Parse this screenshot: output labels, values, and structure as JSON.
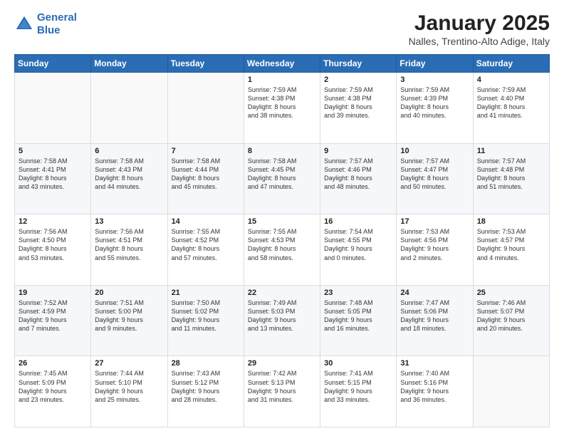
{
  "header": {
    "logo_line1": "General",
    "logo_line2": "Blue",
    "main_title": "January 2025",
    "subtitle": "Nalles, Trentino-Alto Adige, Italy"
  },
  "days_of_week": [
    "Sunday",
    "Monday",
    "Tuesday",
    "Wednesday",
    "Thursday",
    "Friday",
    "Saturday"
  ],
  "weeks": [
    [
      {
        "day": "",
        "info": ""
      },
      {
        "day": "",
        "info": ""
      },
      {
        "day": "",
        "info": ""
      },
      {
        "day": "1",
        "info": "Sunrise: 7:59 AM\nSunset: 4:38 PM\nDaylight: 8 hours\nand 38 minutes."
      },
      {
        "day": "2",
        "info": "Sunrise: 7:59 AM\nSunset: 4:38 PM\nDaylight: 8 hours\nand 39 minutes."
      },
      {
        "day": "3",
        "info": "Sunrise: 7:59 AM\nSunset: 4:39 PM\nDaylight: 8 hours\nand 40 minutes."
      },
      {
        "day": "4",
        "info": "Sunrise: 7:59 AM\nSunset: 4:40 PM\nDaylight: 8 hours\nand 41 minutes."
      }
    ],
    [
      {
        "day": "5",
        "info": "Sunrise: 7:58 AM\nSunset: 4:41 PM\nDaylight: 8 hours\nand 43 minutes."
      },
      {
        "day": "6",
        "info": "Sunrise: 7:58 AM\nSunset: 4:43 PM\nDaylight: 8 hours\nand 44 minutes."
      },
      {
        "day": "7",
        "info": "Sunrise: 7:58 AM\nSunset: 4:44 PM\nDaylight: 8 hours\nand 45 minutes."
      },
      {
        "day": "8",
        "info": "Sunrise: 7:58 AM\nSunset: 4:45 PM\nDaylight: 8 hours\nand 47 minutes."
      },
      {
        "day": "9",
        "info": "Sunrise: 7:57 AM\nSunset: 4:46 PM\nDaylight: 8 hours\nand 48 minutes."
      },
      {
        "day": "10",
        "info": "Sunrise: 7:57 AM\nSunset: 4:47 PM\nDaylight: 8 hours\nand 50 minutes."
      },
      {
        "day": "11",
        "info": "Sunrise: 7:57 AM\nSunset: 4:48 PM\nDaylight: 8 hours\nand 51 minutes."
      }
    ],
    [
      {
        "day": "12",
        "info": "Sunrise: 7:56 AM\nSunset: 4:50 PM\nDaylight: 8 hours\nand 53 minutes."
      },
      {
        "day": "13",
        "info": "Sunrise: 7:56 AM\nSunset: 4:51 PM\nDaylight: 8 hours\nand 55 minutes."
      },
      {
        "day": "14",
        "info": "Sunrise: 7:55 AM\nSunset: 4:52 PM\nDaylight: 8 hours\nand 57 minutes."
      },
      {
        "day": "15",
        "info": "Sunrise: 7:55 AM\nSunset: 4:53 PM\nDaylight: 8 hours\nand 58 minutes."
      },
      {
        "day": "16",
        "info": "Sunrise: 7:54 AM\nSunset: 4:55 PM\nDaylight: 9 hours\nand 0 minutes."
      },
      {
        "day": "17",
        "info": "Sunrise: 7:53 AM\nSunset: 4:56 PM\nDaylight: 9 hours\nand 2 minutes."
      },
      {
        "day": "18",
        "info": "Sunrise: 7:53 AM\nSunset: 4:57 PM\nDaylight: 9 hours\nand 4 minutes."
      }
    ],
    [
      {
        "day": "19",
        "info": "Sunrise: 7:52 AM\nSunset: 4:59 PM\nDaylight: 9 hours\nand 7 minutes."
      },
      {
        "day": "20",
        "info": "Sunrise: 7:51 AM\nSunset: 5:00 PM\nDaylight: 9 hours\nand 9 minutes."
      },
      {
        "day": "21",
        "info": "Sunrise: 7:50 AM\nSunset: 5:02 PM\nDaylight: 9 hours\nand 11 minutes."
      },
      {
        "day": "22",
        "info": "Sunrise: 7:49 AM\nSunset: 5:03 PM\nDaylight: 9 hours\nand 13 minutes."
      },
      {
        "day": "23",
        "info": "Sunrise: 7:48 AM\nSunset: 5:05 PM\nDaylight: 9 hours\nand 16 minutes."
      },
      {
        "day": "24",
        "info": "Sunrise: 7:47 AM\nSunset: 5:06 PM\nDaylight: 9 hours\nand 18 minutes."
      },
      {
        "day": "25",
        "info": "Sunrise: 7:46 AM\nSunset: 5:07 PM\nDaylight: 9 hours\nand 20 minutes."
      }
    ],
    [
      {
        "day": "26",
        "info": "Sunrise: 7:45 AM\nSunset: 5:09 PM\nDaylight: 9 hours\nand 23 minutes."
      },
      {
        "day": "27",
        "info": "Sunrise: 7:44 AM\nSunset: 5:10 PM\nDaylight: 9 hours\nand 25 minutes."
      },
      {
        "day": "28",
        "info": "Sunrise: 7:43 AM\nSunset: 5:12 PM\nDaylight: 9 hours\nand 28 minutes."
      },
      {
        "day": "29",
        "info": "Sunrise: 7:42 AM\nSunset: 5:13 PM\nDaylight: 9 hours\nand 31 minutes."
      },
      {
        "day": "30",
        "info": "Sunrise: 7:41 AM\nSunset: 5:15 PM\nDaylight: 9 hours\nand 33 minutes."
      },
      {
        "day": "31",
        "info": "Sunrise: 7:40 AM\nSunset: 5:16 PM\nDaylight: 9 hours\nand 36 minutes."
      },
      {
        "day": "",
        "info": ""
      }
    ]
  ]
}
